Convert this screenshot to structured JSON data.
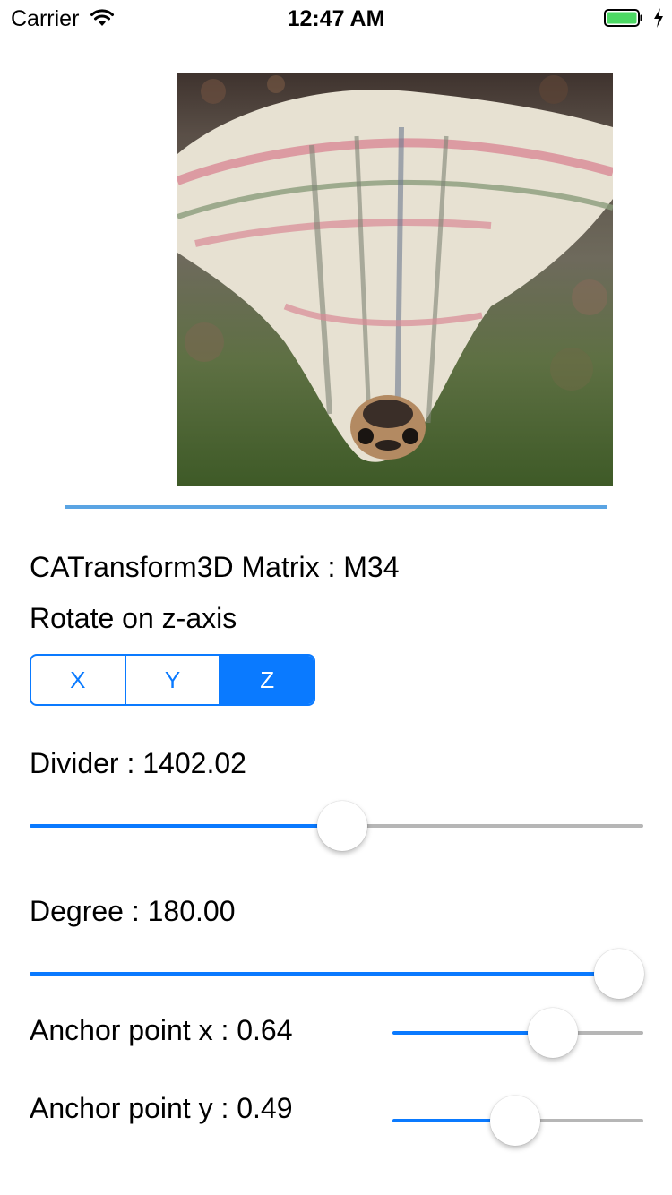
{
  "status_bar": {
    "carrier": "Carrier",
    "time": "12:47 AM",
    "battery_level": 1.0
  },
  "controls": {
    "title": "CATransform3D Matrix : M34",
    "rotate_label": "Rotate on z-axis",
    "segments": [
      "X",
      "Y",
      "Z"
    ],
    "selected_segment": "Z",
    "divider": {
      "label": "Divider : 1402.02",
      "fraction": 0.51
    },
    "degree": {
      "label": "Degree : 180.00",
      "fraction": 1.0
    },
    "anchor_x": {
      "label": "Anchor point x : 0.64",
      "value": 0.64
    },
    "anchor_y": {
      "label": "Anchor point y : 0.49",
      "value": 0.49
    }
  },
  "colors": {
    "accent": "#0a7aff",
    "separator": "#5aa4e3",
    "track_off": "#b6b6b6"
  }
}
